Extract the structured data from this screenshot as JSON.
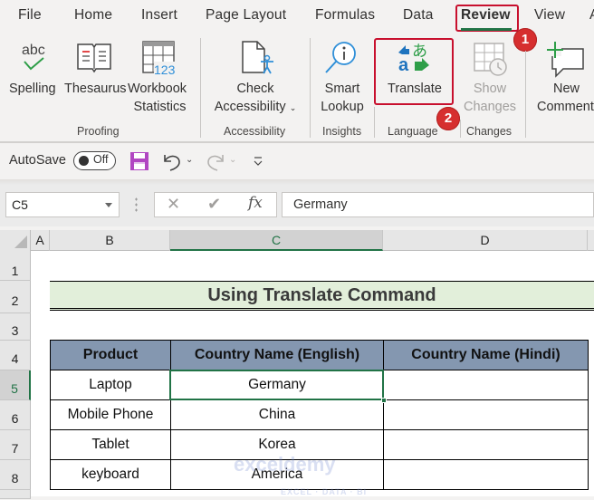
{
  "menu": {
    "tabs": [
      "File",
      "Home",
      "Insert",
      "Page Layout",
      "Formulas",
      "Data",
      "Review",
      "View",
      "A"
    ],
    "active_tab": "Review"
  },
  "ribbon": {
    "groups": [
      {
        "label": "Proofing",
        "buttons": [
          {
            "label": "Spelling",
            "icon": "spelling-abc-check-icon"
          },
          {
            "label": "Thesaurus",
            "icon": "book-icon"
          },
          {
            "label1": "Workbook",
            "label2": "Statistics",
            "icon": "workbook-statistics-icon",
            "icon_text": "123",
            "abc": "abc"
          }
        ]
      },
      {
        "label": "Accessibility",
        "buttons": [
          {
            "label1": "Check",
            "label2": "Accessibility",
            "icon": "check-accessibility-icon",
            "has_dropdown": true
          }
        ]
      },
      {
        "label": "Insights",
        "buttons": [
          {
            "label1": "Smart",
            "label2": "Lookup",
            "icon": "smart-lookup-icon"
          }
        ]
      },
      {
        "label": "Language",
        "buttons": [
          {
            "label": "Translate",
            "icon": "translate-icon",
            "glyph_a": "a",
            "glyph_jp": "あ"
          }
        ]
      },
      {
        "label": "Changes",
        "buttons": [
          {
            "label1": "Show",
            "label2": "Changes",
            "icon": "show-changes-icon",
            "disabled": true
          }
        ]
      },
      {
        "label": "",
        "buttons": [
          {
            "label1": "New",
            "label2": "Comment",
            "icon": "new-comment-icon"
          }
        ]
      }
    ]
  },
  "annotations": {
    "badge1": "1",
    "badge2": "2",
    "color": "#d62f2f"
  },
  "qat": {
    "autosave_label": "AutoSave",
    "autosave_state": "Off"
  },
  "formula_bar": {
    "name_box": "C5",
    "fx_label": "fx",
    "value": "Germany"
  },
  "grid": {
    "columns": [
      "A",
      "B",
      "C",
      "D"
    ],
    "selected_column": "C",
    "rows": [
      "1",
      "2",
      "3",
      "4",
      "5",
      "6",
      "7",
      "8"
    ],
    "selected_row": "5"
  },
  "sheet": {
    "title": "Using Translate Command",
    "table": {
      "headers": [
        "Product",
        "Country Name (English)",
        "Country Name (Hindi)"
      ],
      "rows": [
        [
          "Laptop",
          "Germany",
          ""
        ],
        [
          "Mobile Phone",
          "China",
          ""
        ],
        [
          "Tablet",
          "Korea",
          ""
        ],
        [
          "keyboard",
          "America",
          ""
        ]
      ]
    }
  },
  "watermark": {
    "text": "exceldemy",
    "sub": "EXCEL · DATA · BI"
  },
  "colors": {
    "accent_green": "#217346",
    "title_fill": "#e2efda",
    "header_fill": "#8497b0",
    "highlight_red": "#c8102e",
    "save_icon": "#b146c2"
  }
}
